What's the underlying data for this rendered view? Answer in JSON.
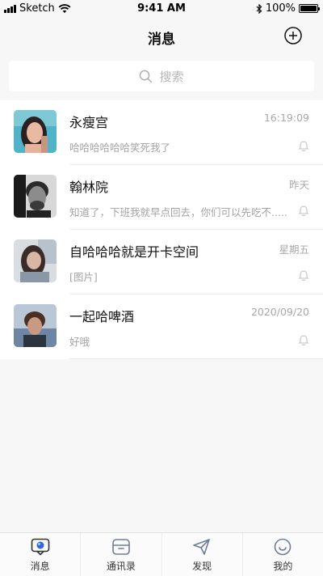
{
  "status_bar": {
    "carrier": "Sketch",
    "time": "9:41 AM",
    "battery": "100%"
  },
  "nav": {
    "title": "消息",
    "add_icon": "plus-circle-icon"
  },
  "search": {
    "placeholder": "搜索",
    "icon": "search-icon"
  },
  "conversations": [
    {
      "name": "永瘦宫",
      "time": "16:19:09",
      "preview": "哈哈哈哈哈哈笑死我了",
      "muted_icon": "bell-icon"
    },
    {
      "name": "翰林院",
      "time": "昨天",
      "preview": "知道了，下班我就早点回去，你们可以先吃不.....",
      "muted_icon": "bell-icon"
    },
    {
      "name": "自哈哈哈就是开卡空间",
      "time": "星期五",
      "preview": "[图片]",
      "muted_icon": "bell-icon"
    },
    {
      "name": "一起哈啤酒",
      "time": "2020/09/20",
      "preview": "好哦",
      "muted_icon": "bell-icon"
    }
  ],
  "tabs": [
    {
      "label": "消息",
      "icon": "chat-icon"
    },
    {
      "label": "通讯录",
      "icon": "contacts-icon"
    },
    {
      "label": "发现",
      "icon": "paper-plane-icon"
    },
    {
      "label": "我的",
      "icon": "smile-icon"
    }
  ]
}
